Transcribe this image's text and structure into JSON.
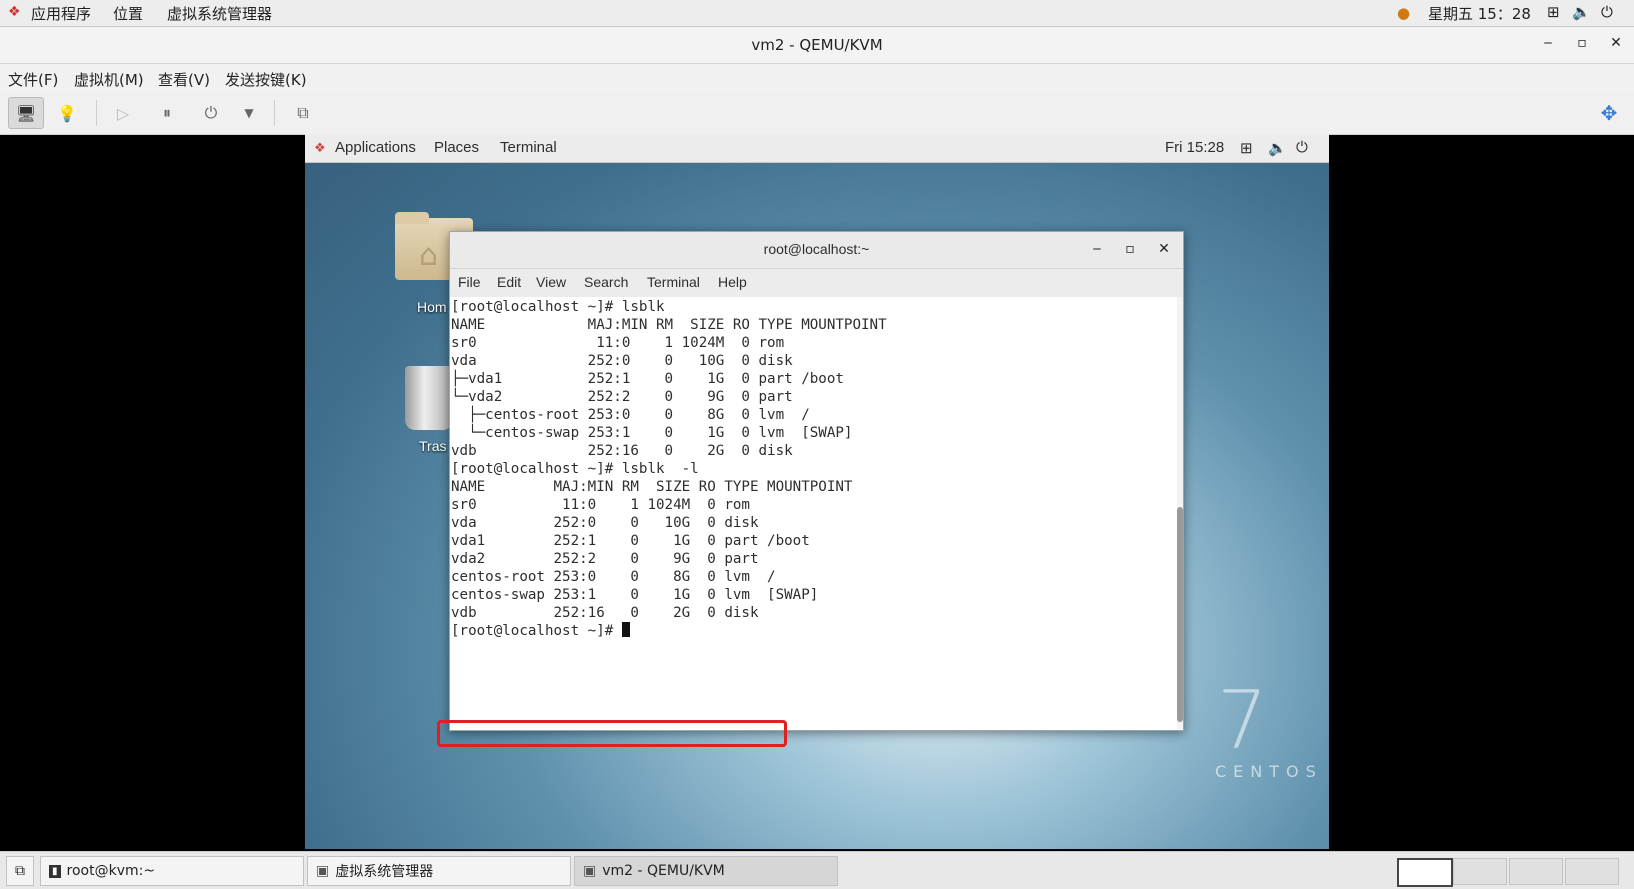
{
  "host_panel": {
    "apps": "应用程序",
    "places": "位置",
    "vmm": "虚拟系统管理器",
    "clock": "星期五 15：28"
  },
  "qemu_window": {
    "title": "vm2 - QEMU/KVM",
    "menu": [
      "文件(F)",
      "虚拟机(M)",
      "查看(V)",
      "发送按键(K)"
    ]
  },
  "guest": {
    "panel": {
      "applications": "Applications",
      "places": "Places",
      "terminal": "Terminal",
      "clock": "Fri 15:28"
    },
    "desktop_icons": {
      "home_label": "Hom",
      "trash_label": "Tras"
    },
    "logo": {
      "number": "7",
      "word": "CENTOS"
    },
    "terminal_window": {
      "title": "root@localhost:~",
      "menu": [
        "File",
        "Edit",
        "View",
        "Search",
        "Terminal",
        "Help"
      ],
      "lines": [
        "[root@localhost ~]# lsblk",
        "NAME            MAJ:MIN RM  SIZE RO TYPE MOUNTPOINT",
        "sr0              11:0    1 1024M  0 rom",
        "vda             252:0    0   10G  0 disk",
        "├─vda1          252:1    0    1G  0 part /boot",
        "└─vda2          252:2    0    9G  0 part",
        "  ├─centos-root 253:0    0    8G  0 lvm  /",
        "  └─centos-swap 253:1    0    1G  0 lvm  [SWAP]",
        "vdb             252:16   0    2G  0 disk",
        "[root@localhost ~]# lsblk  -l",
        "NAME        MAJ:MIN RM  SIZE RO TYPE MOUNTPOINT",
        "sr0          11:0    1 1024M  0 rom",
        "vda         252:0    0   10G  0 disk",
        "vda1        252:1    0    1G  0 part /boot",
        "vda2        252:2    0    9G  0 part",
        "centos-root 253:0    0    8G  0 lvm  /",
        "centos-swap 253:1    0    1G  0 lvm  [SWAP]",
        "vdb         252:16   0    2G  0 disk"
      ],
      "prompt": "[root@localhost ~]# "
    }
  },
  "taskbar": {
    "tasks": [
      "root@kvm:~",
      "虚拟系统管理器",
      "vm2 - QEMU/KVM"
    ]
  },
  "colors": {
    "highlight": "#e02020",
    "panel": "#ededed"
  }
}
